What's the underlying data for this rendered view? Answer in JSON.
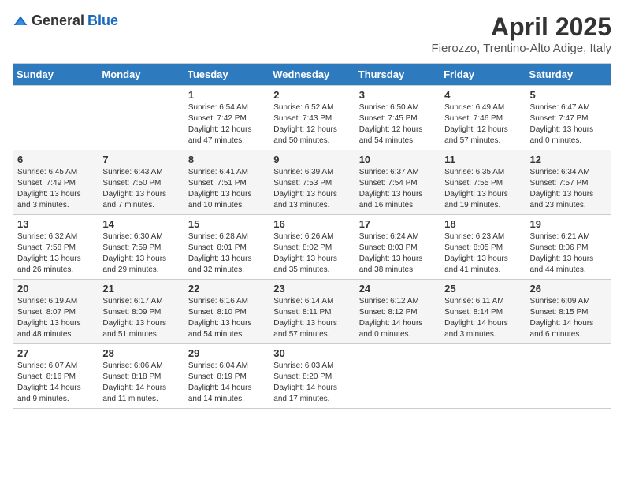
{
  "header": {
    "logo_general": "General",
    "logo_blue": "Blue",
    "month": "April 2025",
    "location": "Fierozzo, Trentino-Alto Adige, Italy"
  },
  "weekdays": [
    "Sunday",
    "Monday",
    "Tuesday",
    "Wednesday",
    "Thursday",
    "Friday",
    "Saturday"
  ],
  "weeks": [
    [
      null,
      null,
      {
        "day": 1,
        "sunrise": "6:54 AM",
        "sunset": "7:42 PM",
        "daylight": "12 hours and 47 minutes."
      },
      {
        "day": 2,
        "sunrise": "6:52 AM",
        "sunset": "7:43 PM",
        "daylight": "12 hours and 50 minutes."
      },
      {
        "day": 3,
        "sunrise": "6:50 AM",
        "sunset": "7:45 PM",
        "daylight": "12 hours and 54 minutes."
      },
      {
        "day": 4,
        "sunrise": "6:49 AM",
        "sunset": "7:46 PM",
        "daylight": "12 hours and 57 minutes."
      },
      {
        "day": 5,
        "sunrise": "6:47 AM",
        "sunset": "7:47 PM",
        "daylight": "13 hours and 0 minutes."
      }
    ],
    [
      {
        "day": 6,
        "sunrise": "6:45 AM",
        "sunset": "7:49 PM",
        "daylight": "13 hours and 3 minutes."
      },
      {
        "day": 7,
        "sunrise": "6:43 AM",
        "sunset": "7:50 PM",
        "daylight": "13 hours and 7 minutes."
      },
      {
        "day": 8,
        "sunrise": "6:41 AM",
        "sunset": "7:51 PM",
        "daylight": "13 hours and 10 minutes."
      },
      {
        "day": 9,
        "sunrise": "6:39 AM",
        "sunset": "7:53 PM",
        "daylight": "13 hours and 13 minutes."
      },
      {
        "day": 10,
        "sunrise": "6:37 AM",
        "sunset": "7:54 PM",
        "daylight": "13 hours and 16 minutes."
      },
      {
        "day": 11,
        "sunrise": "6:35 AM",
        "sunset": "7:55 PM",
        "daylight": "13 hours and 19 minutes."
      },
      {
        "day": 12,
        "sunrise": "6:34 AM",
        "sunset": "7:57 PM",
        "daylight": "13 hours and 23 minutes."
      }
    ],
    [
      {
        "day": 13,
        "sunrise": "6:32 AM",
        "sunset": "7:58 PM",
        "daylight": "13 hours and 26 minutes."
      },
      {
        "day": 14,
        "sunrise": "6:30 AM",
        "sunset": "7:59 PM",
        "daylight": "13 hours and 29 minutes."
      },
      {
        "day": 15,
        "sunrise": "6:28 AM",
        "sunset": "8:01 PM",
        "daylight": "13 hours and 32 minutes."
      },
      {
        "day": 16,
        "sunrise": "6:26 AM",
        "sunset": "8:02 PM",
        "daylight": "13 hours and 35 minutes."
      },
      {
        "day": 17,
        "sunrise": "6:24 AM",
        "sunset": "8:03 PM",
        "daylight": "13 hours and 38 minutes."
      },
      {
        "day": 18,
        "sunrise": "6:23 AM",
        "sunset": "8:05 PM",
        "daylight": "13 hours and 41 minutes."
      },
      {
        "day": 19,
        "sunrise": "6:21 AM",
        "sunset": "8:06 PM",
        "daylight": "13 hours and 44 minutes."
      }
    ],
    [
      {
        "day": 20,
        "sunrise": "6:19 AM",
        "sunset": "8:07 PM",
        "daylight": "13 hours and 48 minutes."
      },
      {
        "day": 21,
        "sunrise": "6:17 AM",
        "sunset": "8:09 PM",
        "daylight": "13 hours and 51 minutes."
      },
      {
        "day": 22,
        "sunrise": "6:16 AM",
        "sunset": "8:10 PM",
        "daylight": "13 hours and 54 minutes."
      },
      {
        "day": 23,
        "sunrise": "6:14 AM",
        "sunset": "8:11 PM",
        "daylight": "13 hours and 57 minutes."
      },
      {
        "day": 24,
        "sunrise": "6:12 AM",
        "sunset": "8:12 PM",
        "daylight": "14 hours and 0 minutes."
      },
      {
        "day": 25,
        "sunrise": "6:11 AM",
        "sunset": "8:14 PM",
        "daylight": "14 hours and 3 minutes."
      },
      {
        "day": 26,
        "sunrise": "6:09 AM",
        "sunset": "8:15 PM",
        "daylight": "14 hours and 6 minutes."
      }
    ],
    [
      {
        "day": 27,
        "sunrise": "6:07 AM",
        "sunset": "8:16 PM",
        "daylight": "14 hours and 9 minutes."
      },
      {
        "day": 28,
        "sunrise": "6:06 AM",
        "sunset": "8:18 PM",
        "daylight": "14 hours and 11 minutes."
      },
      {
        "day": 29,
        "sunrise": "6:04 AM",
        "sunset": "8:19 PM",
        "daylight": "14 hours and 14 minutes."
      },
      {
        "day": 30,
        "sunrise": "6:03 AM",
        "sunset": "8:20 PM",
        "daylight": "14 hours and 17 minutes."
      },
      null,
      null,
      null
    ]
  ]
}
